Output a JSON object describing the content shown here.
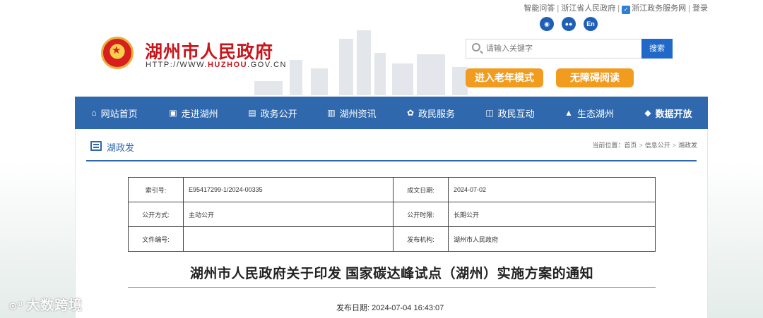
{
  "top_links": {
    "qa": "智能问答",
    "province_gov": "浙江省人民政府",
    "zj_service": "浙江政务服务网",
    "login": "登录"
  },
  "social": {
    "weibo_icon": "weibo-icon",
    "wechat_icon": "wechat-icon",
    "english_label": "En"
  },
  "header": {
    "site_title": "湖州市人民政府",
    "site_url_prefix": "HTTP://WWW.",
    "site_url_brand": "HUZHOU",
    "site_url_suffix": ".GOV.CN"
  },
  "search": {
    "placeholder": "请输入关键字",
    "button_label": "搜索"
  },
  "mode_buttons": {
    "elder_mode": "进入老年模式",
    "accessible_reading": "无障碍阅读"
  },
  "nav": {
    "items": [
      {
        "label": "网站首页",
        "icon": "⌂"
      },
      {
        "label": "走进湖州",
        "icon": "▣"
      },
      {
        "label": "政务公开",
        "icon": "▤"
      },
      {
        "label": "湖州资讯",
        "icon": "▥"
      },
      {
        "label": "政民服务",
        "icon": "✿"
      },
      {
        "label": "政民互动",
        "icon": "◫"
      },
      {
        "label": "生态湖州",
        "icon": "▲"
      },
      {
        "label": "数据开放",
        "icon": "◆"
      }
    ]
  },
  "page": {
    "category": "湖政发",
    "breadcrumb": {
      "prefix": "当前位置：",
      "home": "首页",
      "section": "信息公开",
      "current": "湖政发"
    }
  },
  "info_table": {
    "rows": [
      {
        "label1": "索引号:",
        "value1": "E95417299-1/2024-00335",
        "label2": "成文日期:",
        "value2": "2024-07-02"
      },
      {
        "label1": "公开方式:",
        "value1": "主动公开",
        "label2": "公开时限:",
        "value2": "长期公开"
      },
      {
        "label1": "文件编号:",
        "value1": "",
        "label2": "发布机构:",
        "value2": "湖州市人民政府"
      }
    ]
  },
  "document": {
    "title": "湖州市人民政府关于印发 国家碳达峰试点（湖州）实施方案的通知",
    "publish_label": "发布日期:",
    "publish_time": "2024-07-04 16:43:07"
  },
  "watermark": {
    "text": "大数跨境"
  },
  "colors": {
    "brand_red": "#c8161d",
    "nav_blue": "#2f68ad",
    "search_blue": "#2069c8",
    "accent_orange": "#f29c1f"
  }
}
